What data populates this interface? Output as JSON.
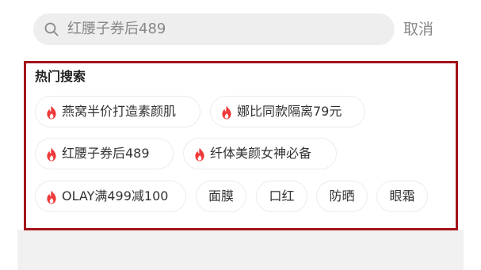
{
  "search": {
    "value": "红腰子券后489",
    "cancel_label": "取消"
  },
  "hot_search": {
    "title": "热门搜索",
    "items": [
      {
        "label": "燕窝半价打造素颜肌",
        "hot": true
      },
      {
        "label": "娜比同款隔离79元",
        "hot": true
      },
      {
        "label": "红腰子券后489",
        "hot": true
      },
      {
        "label": "纤体美颜女神必备",
        "hot": true
      },
      {
        "label": "OLAY满499减100",
        "hot": true
      },
      {
        "label": "面膜",
        "hot": false
      },
      {
        "label": "口红",
        "hot": false
      },
      {
        "label": "防晒",
        "hot": false
      },
      {
        "label": "眼霜",
        "hot": false
      }
    ]
  },
  "colors": {
    "hot_icon": "#f0393a",
    "highlight_border": "#a3141b",
    "search_bg": "#eeeeee"
  },
  "icons": {
    "search": "search-icon",
    "hot": "fire-icon"
  }
}
